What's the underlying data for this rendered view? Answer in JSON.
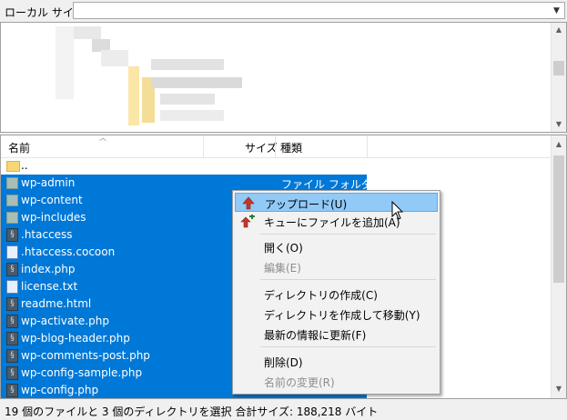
{
  "site_bar": {
    "label": "ローカル サイト:",
    "value": ""
  },
  "file_list": {
    "columns": {
      "name": "名前",
      "size": "サイズ",
      "type": "種類"
    },
    "rows": [
      {
        "name": "..",
        "type": "",
        "icon": "folder-icon",
        "selected": false
      },
      {
        "name": "wp-admin",
        "type": "ファイル フォルダー",
        "icon": "folder-icon",
        "selected": true
      },
      {
        "name": "wp-content",
        "type": "",
        "icon": "folder-icon",
        "selected": true
      },
      {
        "name": "wp-includes",
        "type": "",
        "icon": "folder-icon",
        "selected": true
      },
      {
        "name": ".htaccess",
        "type": "",
        "icon": "php-file-icon",
        "selected": true
      },
      {
        "name": ".htaccess.cocoon",
        "type": "",
        "icon": "document-icon",
        "selected": true
      },
      {
        "name": "index.php",
        "type": "",
        "icon": "php-file-icon",
        "selected": true
      },
      {
        "name": "license.txt",
        "type": "",
        "icon": "document-icon",
        "selected": true
      },
      {
        "name": "readme.html",
        "type": "",
        "icon": "php-file-icon",
        "selected": true
      },
      {
        "name": "wp-activate.php",
        "type": "",
        "icon": "php-file-icon",
        "selected": true
      },
      {
        "name": "wp-blog-header.php",
        "type": "",
        "icon": "php-file-icon",
        "selected": true
      },
      {
        "name": "wp-comments-post.php",
        "type": "",
        "icon": "php-file-icon",
        "selected": true
      },
      {
        "name": "wp-config-sample.php",
        "type": "",
        "icon": "php-file-icon",
        "selected": true
      },
      {
        "name": "wp-config.php",
        "type": "",
        "icon": "php-file-icon",
        "selected": true
      }
    ]
  },
  "context_menu": {
    "upload": "アップロード(U)",
    "add_to_queue": "キューにファイルを追加(A)",
    "open": "開く(O)",
    "edit": "編集(E)",
    "create_dir": "ディレクトリの作成(C)",
    "create_dir_enter": "ディレクトリを作成して移動(Y)",
    "refresh": "最新の情報に更新(F)",
    "delete": "削除(D)",
    "rename": "名前の変更(R)"
  },
  "status_bar": {
    "text": "19 個のファイルと 3 個のディレクトリを選択 合計サイズ: 188,218 バイト"
  },
  "colors": {
    "selection": "#0078d7",
    "menu_highlight": "#91c9f7",
    "folder": "#f7d774",
    "upload_arrow": "#c0392b"
  }
}
